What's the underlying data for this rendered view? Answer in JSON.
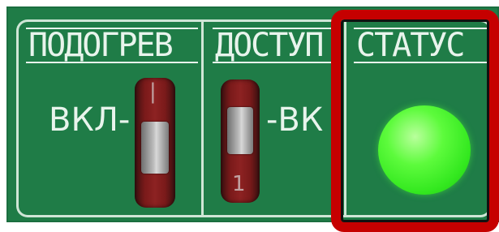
{
  "panel": {
    "background_color": "#1f7c47",
    "sections": [
      {
        "title": "ПОДОГРЕВ"
      },
      {
        "title": "ДОСТУП"
      },
      {
        "title": "СТАТУС"
      }
    ],
    "switches": {
      "heating": {
        "label": "ВКЛ-",
        "state": "off"
      },
      "access": {
        "label": "-ВК",
        "state": "on"
      }
    },
    "status_lamp": {
      "color": "#33e81f",
      "state": "on"
    },
    "highlight_color": "#c60000"
  }
}
